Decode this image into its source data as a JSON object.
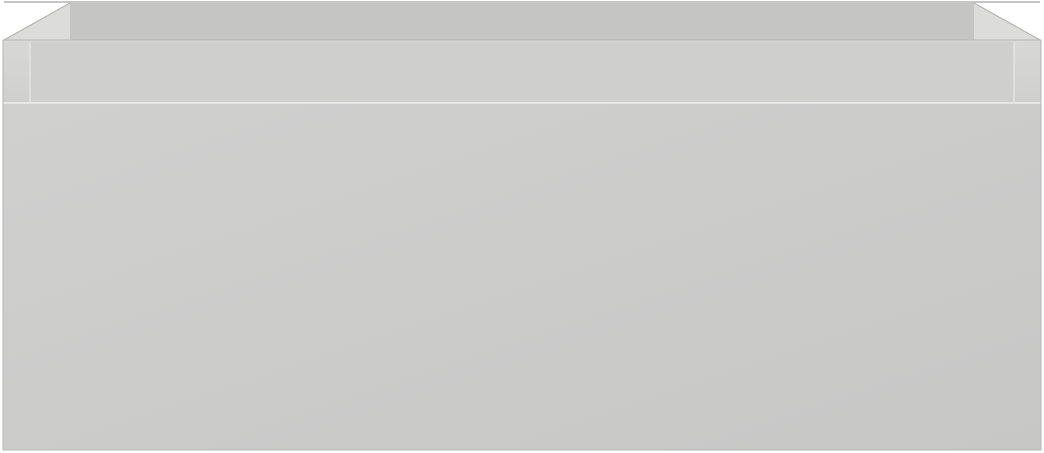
{
  "object": {
    "kind": "drawer-front-render",
    "colors": {
      "background": "#ffffff",
      "front_light": "#d0d0cf",
      "front_dark": "#c7c7c6",
      "rim_light": "#d8d8d7",
      "rim_dark": "#cfcfce",
      "inner_back": "#c5c5c4",
      "inner_floor": "#bdbdbc",
      "inner_side": "#dcdcdb",
      "edge_highlight": "#eeeeed",
      "edge_shadow": "#b9b9b8",
      "outline": "#b4b4b3"
    }
  }
}
